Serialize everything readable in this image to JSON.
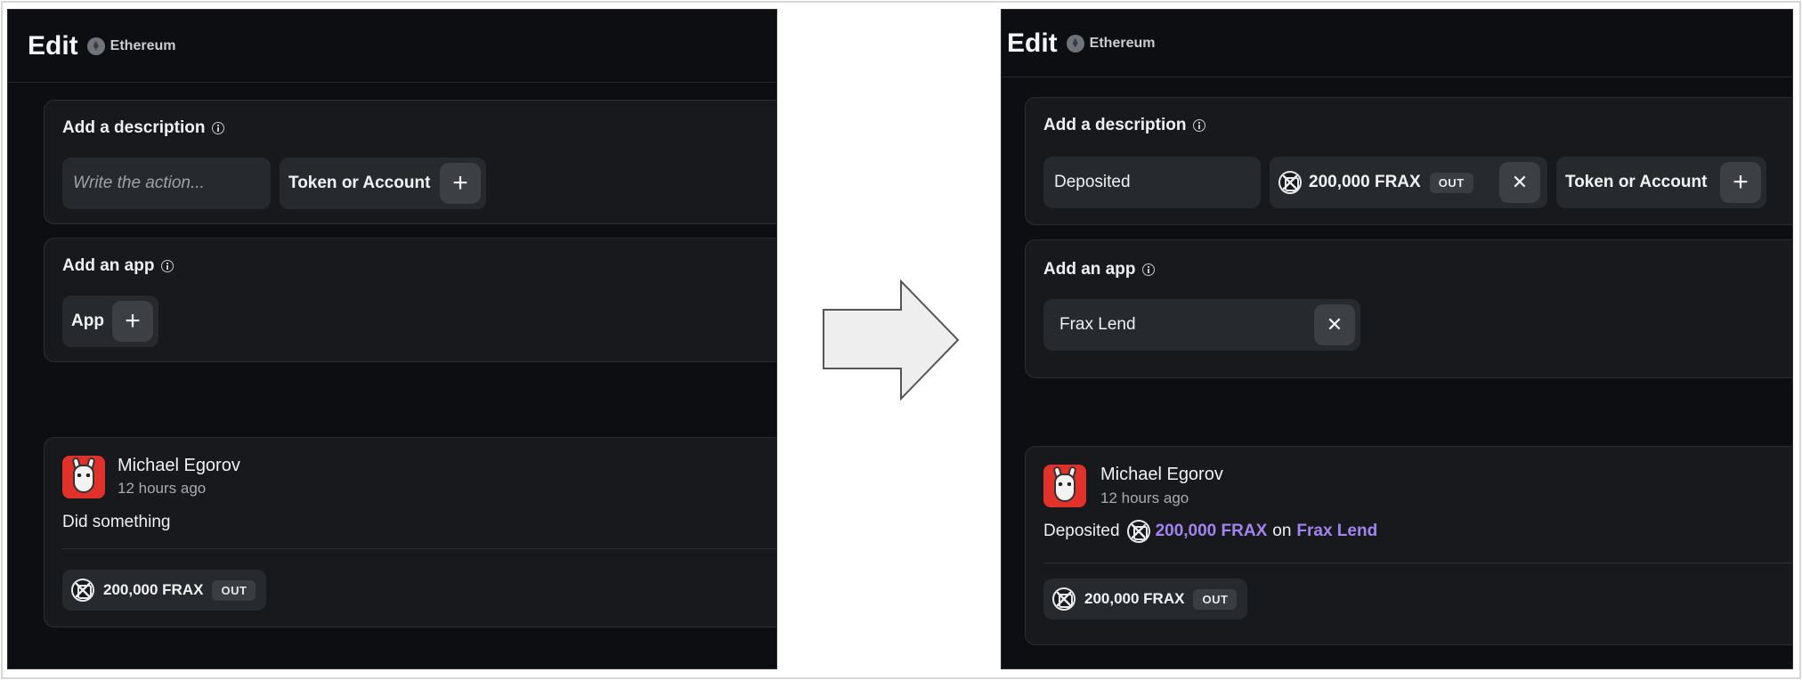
{
  "before": {
    "header": {
      "title": "Edit",
      "chain": "Ethereum"
    },
    "description_card": {
      "label": "Add a description",
      "input_placeholder": "Write the action...",
      "token_button_label": "Token or Account",
      "add_symbol": "+"
    },
    "app_card": {
      "label": "Add an app",
      "app_button_label": "App",
      "add_symbol": "+"
    },
    "activity": {
      "user_name": "Michael Egorov",
      "time_ago": "12 hours ago",
      "text": "Did something",
      "token_amount": "200,000 FRAX",
      "direction": "OUT"
    }
  },
  "after": {
    "header": {
      "title": "Edit",
      "chain": "Ethereum"
    },
    "description_card": {
      "label": "Add a description",
      "input_value": "Deposited",
      "token_amount": "200,000 FRAX",
      "direction": "OUT",
      "remove_symbol": "✕",
      "token_button_label": "Token or Account",
      "add_symbol": "+"
    },
    "app_card": {
      "label": "Add an app",
      "app_value": "Frax Lend",
      "remove_symbol": "✕"
    },
    "activity": {
      "user_name": "Michael Egorov",
      "time_ago": "12 hours ago",
      "text_verb": "Deposited",
      "text_amount": "200,000 FRAX",
      "text_on": "on",
      "text_app": "Frax Lend",
      "token_amount": "200,000 FRAX",
      "direction": "OUT"
    }
  },
  "colors": {
    "panel_bg": "#0c0e11",
    "card_bg": "#17191c",
    "pill_bg": "#26292d",
    "highlight": "#a184f0"
  }
}
